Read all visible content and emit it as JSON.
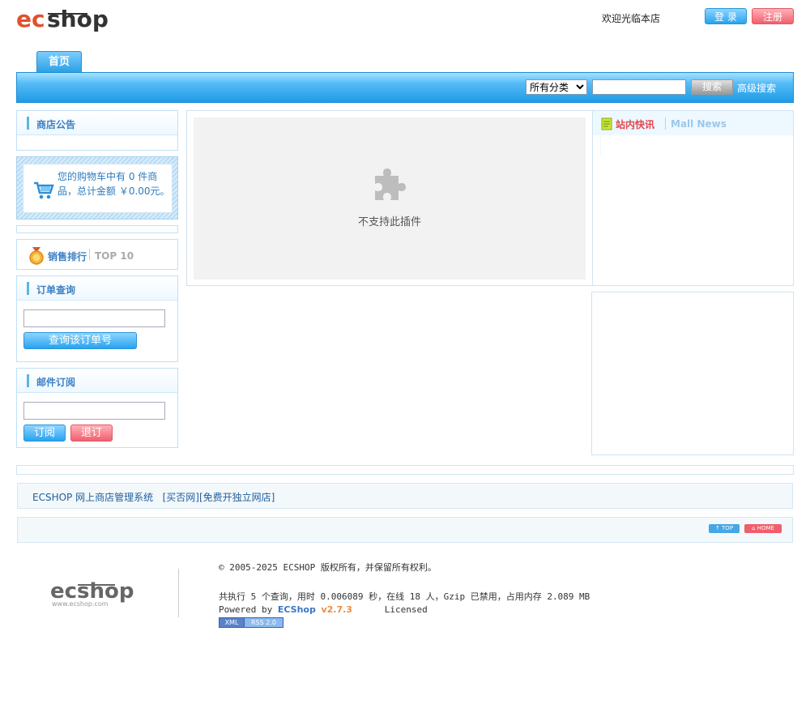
{
  "header": {
    "welcome": "欢迎光临本店",
    "login_label": "登 录",
    "register_label": "注册"
  },
  "nav": {
    "tabs": [
      {
        "label": "首页"
      }
    ],
    "category_options": [
      "所有分类"
    ],
    "category_selected": "所有分类",
    "search_value": "",
    "search_label": "搜索",
    "advanced_search_label": "高级搜索"
  },
  "sidebar": {
    "notice_title": "商店公告",
    "cart_text": "您的购物车中有 0 件商品，总计金额 ￥0.00元。",
    "top10_title": "销售排行",
    "top10_subtitle": "TOP 10",
    "order_query_title": "订单查询",
    "order_input_value": "",
    "order_query_button": "查询该订单号",
    "mail_title": "邮件订阅",
    "mail_input_value": "",
    "subscribe_button": "订阅",
    "unsubscribe_button": "退订"
  },
  "main": {
    "plugin_message": "不支持此插件"
  },
  "news": {
    "title": "站内快讯",
    "subtitle": "Mall News"
  },
  "links": {
    "image_alt": "ECSHOP 网上商店管理系统",
    "link_1": "[买否网]",
    "link_2": "[免费开独立网店]"
  },
  "page_nav": {
    "top_label": "↑ TOP",
    "home_label": "⌂ HOME"
  },
  "footer": {
    "copyright": "© 2005-2025 ECSHOP 版权所有，并保留所有权利。",
    "stats": "共执行 5 个查询，用时 0.006089 秒，在线 18 人，Gzip 已禁用，占用内存 2.089 MB",
    "powered_by": "Powered by ",
    "brand": "ECShop",
    "version": "v2.7.3",
    "licensed": "Licensed",
    "rss_left": "XML",
    "rss_right": "RSS 2.0"
  },
  "colors": {
    "accent_blue": "#27a3ef",
    "accent_red": "#f0606f",
    "link_blue": "#3b7fc4"
  }
}
